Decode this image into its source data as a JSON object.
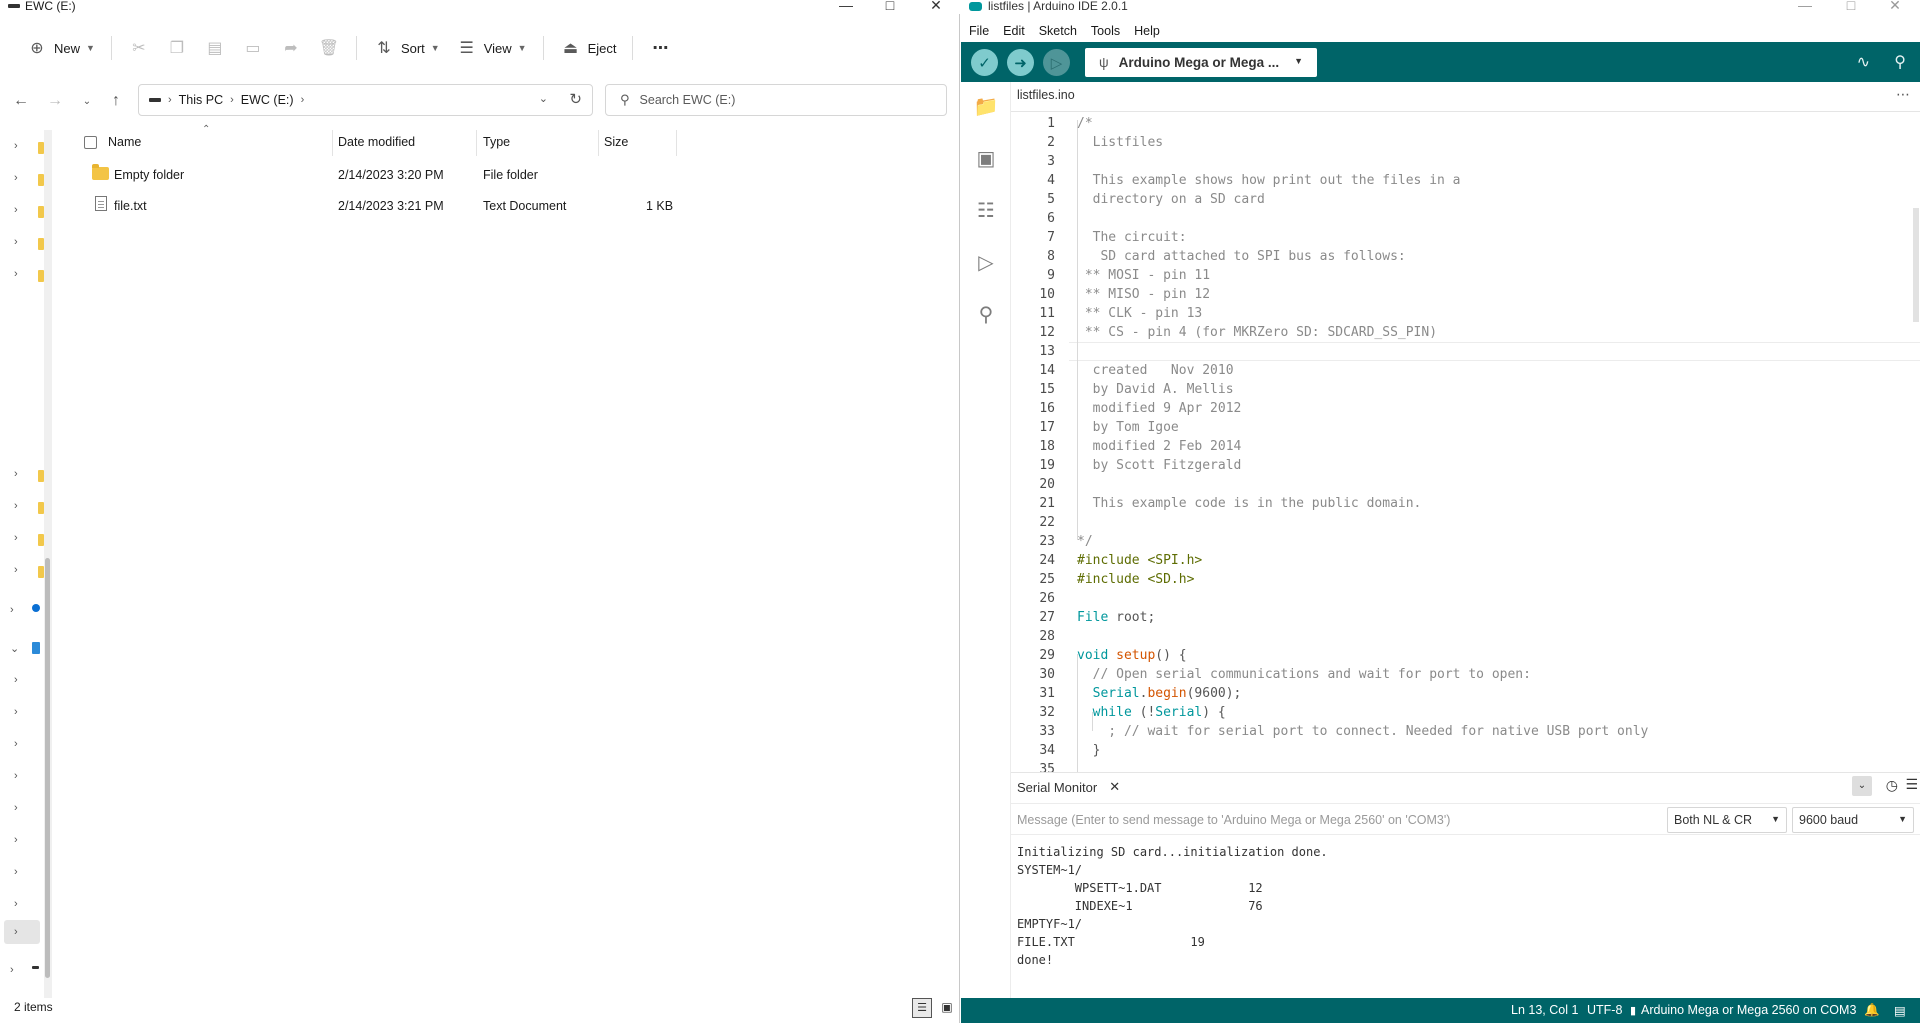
{
  "explorer": {
    "title": "EWC (E:)",
    "toolbar": {
      "new_label": "New",
      "sort_label": "Sort",
      "view_label": "View",
      "eject_label": "Eject",
      "more_label": "⋯"
    },
    "breadcrumbs": [
      "This PC",
      "EWC (E:)"
    ],
    "search_placeholder": "Search EWC (E:)",
    "columns": [
      "Name",
      "Date modified",
      "Type",
      "Size"
    ],
    "files": [
      {
        "name": "Empty folder",
        "date": "2/14/2023 3:20 PM",
        "type": "File folder",
        "size": "",
        "icon": "folder-icon"
      },
      {
        "name": "file.txt",
        "date": "2/14/2023 3:21 PM",
        "type": "Text Document",
        "size": "1 KB",
        "icon": "text-file-icon"
      }
    ],
    "status": "2 items"
  },
  "ide": {
    "title": "listfiles | Arduino IDE 2.0.1",
    "menu": [
      "File",
      "Edit",
      "Sketch",
      "Tools",
      "Help"
    ],
    "board": "Arduino Mega or Mega ...",
    "tab": "listfiles.ino",
    "code_lines": [
      {
        "n": "1",
        "text": "/*"
      },
      {
        "n": "2",
        "text": "  Listfiles"
      },
      {
        "n": "3",
        "text": ""
      },
      {
        "n": "4",
        "text": "  This example shows how print out the files in a"
      },
      {
        "n": "5",
        "text": "  directory on a SD card"
      },
      {
        "n": "6",
        "text": ""
      },
      {
        "n": "7",
        "text": "  The circuit:"
      },
      {
        "n": "8",
        "text": "   SD card attached to SPI bus as follows:"
      },
      {
        "n": "9",
        "text": " ** MOSI - pin 11"
      },
      {
        "n": "10",
        "text": " ** MISO - pin 12"
      },
      {
        "n": "11",
        "text": " ** CLK - pin 13"
      },
      {
        "n": "12",
        "text": " ** CS - pin 4 (for MKRZero SD: SDCARD_SS_PIN)"
      },
      {
        "n": "13",
        "text": ""
      },
      {
        "n": "14",
        "text": "  created   Nov 2010"
      },
      {
        "n": "15",
        "text": "  by David A. Mellis"
      },
      {
        "n": "16",
        "text": "  modified 9 Apr 2012"
      },
      {
        "n": "17",
        "text": "  by Tom Igoe"
      },
      {
        "n": "18",
        "text": "  modified 2 Feb 2014"
      },
      {
        "n": "19",
        "text": "  by Scott Fitzgerald"
      },
      {
        "n": "20",
        "text": ""
      },
      {
        "n": "21",
        "text": "  This example code is in the public domain."
      },
      {
        "n": "22",
        "text": ""
      },
      {
        "n": "23",
        "text": "*/"
      },
      {
        "n": "24",
        "text": "#include <SPI.h>"
      },
      {
        "n": "25",
        "text": "#include <SD.h>"
      },
      {
        "n": "26",
        "text": ""
      },
      {
        "n": "27",
        "text": "File root;"
      },
      {
        "n": "28",
        "text": ""
      },
      {
        "n": "29",
        "text": "void setup() {"
      },
      {
        "n": "30",
        "text": "  // Open serial communications and wait for port to open:"
      },
      {
        "n": "31",
        "text": "  Serial.begin(9600);"
      },
      {
        "n": "32",
        "text": "  while (!Serial) {"
      },
      {
        "n": "33",
        "text": "    ; // wait for serial port to connect. Needed for native USB port only"
      },
      {
        "n": "34",
        "text": "  }"
      },
      {
        "n": "35",
        "text": ""
      }
    ],
    "serial": {
      "title": "Serial Monitor",
      "placeholder": "Message (Enter to send message to 'Arduino Mega or Mega 2560' on 'COM3')",
      "line_ending": "Both NL & CR",
      "baud": "9600 baud",
      "output": "Initializing SD card...initialization done.\nSYSTEM~1/\n\tWPSETT~1.DAT\t\t12\n\tINDEXE~1\t\t76\nEMPTYF~1/\nFILE.TXT\t\t19\ndone!"
    },
    "status": {
      "position": "Ln 13, Col 1",
      "encoding": "UTF-8",
      "board_port": "Arduino Mega or Mega 2560 on COM3"
    }
  },
  "colors": {
    "ide_teal": "#006468",
    "ide_button": "#7fcbcd",
    "folder_yellow": "#f3c445"
  }
}
